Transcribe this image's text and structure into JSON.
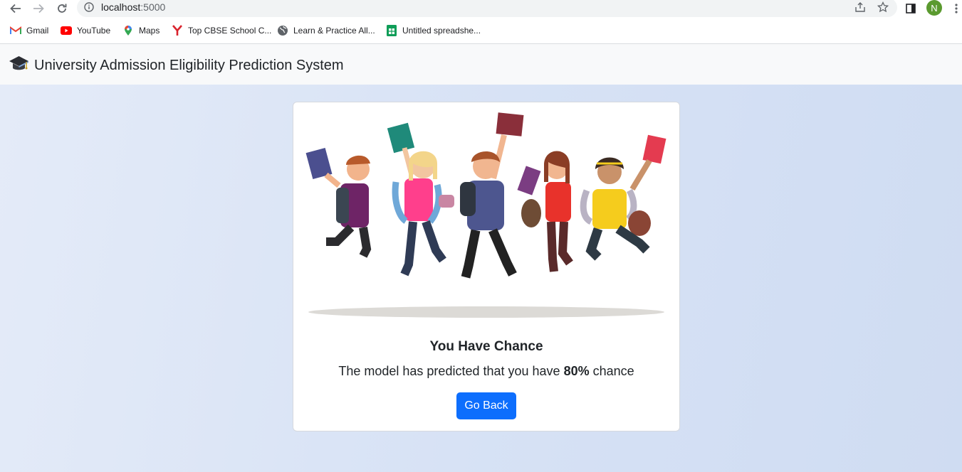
{
  "browser": {
    "url_host": "localhost",
    "url_port": ":5000",
    "profile_initial": "N",
    "bookmarks": [
      {
        "label": "Gmail",
        "icon": "gmail-icon"
      },
      {
        "label": "YouTube",
        "icon": "youtube-icon"
      },
      {
        "label": "Maps",
        "icon": "maps-icon"
      },
      {
        "label": "Top CBSE School C...",
        "icon": "y-logo-icon"
      },
      {
        "label": "Learn & Practice All...",
        "icon": "globe-icon"
      },
      {
        "label": "Untitled spreadshe...",
        "icon": "sheets-icon"
      }
    ]
  },
  "navbar": {
    "title": "University Admission Eligibility Prediction System",
    "icon": "graduation-cap-icon"
  },
  "result": {
    "heading": "You Have Chance",
    "text_prefix": "The model has predicted that you have ",
    "percentage": "80%",
    "text_suffix": " chance",
    "button_label": "Go Back"
  },
  "colors": {
    "primary": "#0d6efd",
    "navbar_bg": "#f8f9fa",
    "page_bg": "#dbe5f6"
  }
}
